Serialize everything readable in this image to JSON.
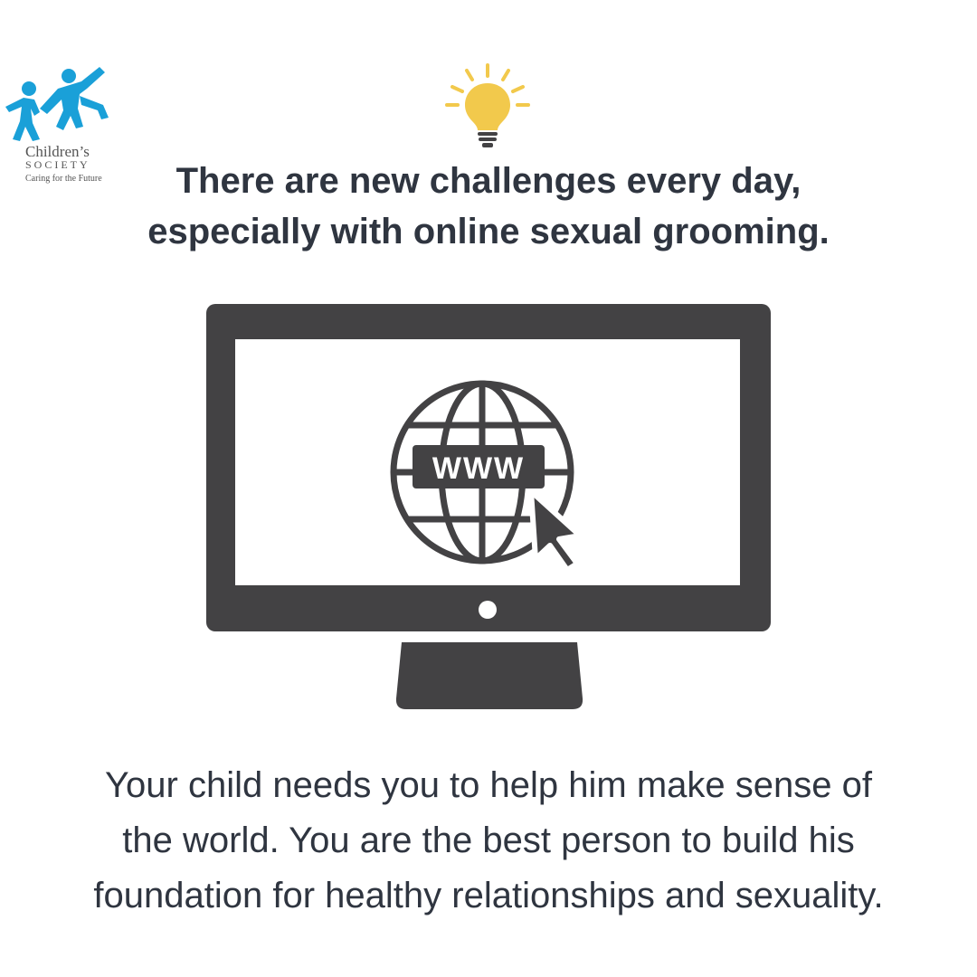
{
  "logo": {
    "name": "Children’s",
    "society": "SOCIETY",
    "tagline": "Caring for the Future",
    "color": "#1aa0d8"
  },
  "headline": {
    "line1": "There are new challenges every day,",
    "line2": "especially with online sexual grooming."
  },
  "screen": {
    "globe_label": "WWW"
  },
  "body": {
    "line1": "Your child needs you to help him make sense of",
    "line2": "the world. You are the best person to build his",
    "line3": "foundation for healthy relationships and sexuality."
  },
  "colors": {
    "bulb": "#f2c94c",
    "monitor": "#434244",
    "text": "#2f3540"
  },
  "icons": [
    "lightbulb-icon",
    "monitor-icon",
    "globe-icon",
    "cursor-arrow-icon"
  ]
}
